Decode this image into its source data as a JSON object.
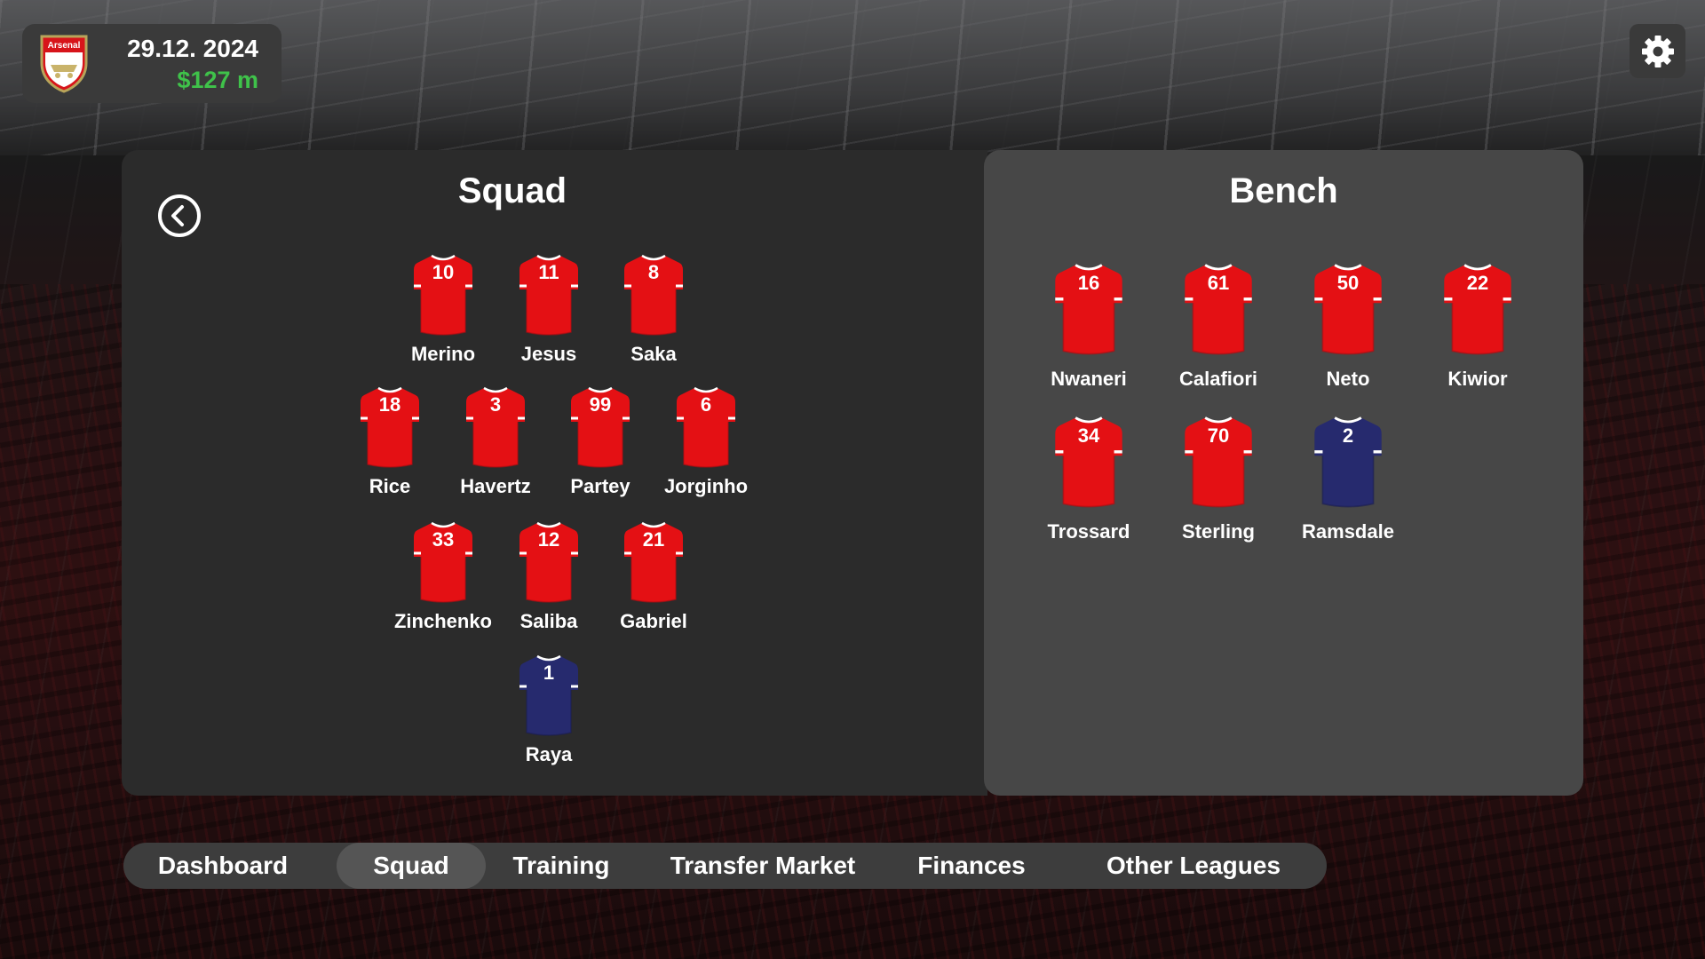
{
  "header": {
    "club_name": "Arsenal",
    "date": "29.12. 2024",
    "budget": "$127 m",
    "budget_color": "#3fc24a",
    "settings_icon": "gear-icon"
  },
  "squad": {
    "title": "Squad",
    "back_icon": "chevron-left-circle-icon",
    "players": [
      {
        "number": "10",
        "name": "Merino",
        "kit": "red"
      },
      {
        "number": "11",
        "name": "Jesus",
        "kit": "red"
      },
      {
        "number": "8",
        "name": "Saka",
        "kit": "red"
      },
      {
        "number": "18",
        "name": "Rice",
        "kit": "red"
      },
      {
        "number": "3",
        "name": "Havertz",
        "kit": "red"
      },
      {
        "number": "99",
        "name": "Partey",
        "kit": "red"
      },
      {
        "number": "6",
        "name": "Jorginho",
        "kit": "red"
      },
      {
        "number": "33",
        "name": "Zinchenko",
        "kit": "red"
      },
      {
        "number": "12",
        "name": "Saliba",
        "kit": "red"
      },
      {
        "number": "21",
        "name": "Gabriel",
        "kit": "red"
      },
      {
        "number": "1",
        "name": "Raya",
        "kit": "navy"
      }
    ]
  },
  "bench": {
    "title": "Bench",
    "players": [
      {
        "number": "16",
        "name": "Nwaneri",
        "kit": "red"
      },
      {
        "number": "61",
        "name": "Calafiori",
        "kit": "red"
      },
      {
        "number": "50",
        "name": "Neto",
        "kit": "red"
      },
      {
        "number": "22",
        "name": "Kiwior",
        "kit": "red"
      },
      {
        "number": "34",
        "name": "Trossard",
        "kit": "red"
      },
      {
        "number": "70",
        "name": "Sterling",
        "kit": "red"
      },
      {
        "number": "2",
        "name": "Ramsdale",
        "kit": "navy"
      }
    ]
  },
  "nav": {
    "items": [
      "Dashboard",
      "Squad",
      "Training",
      "Transfer Market",
      "Finances",
      "Other Leagues"
    ],
    "active": "Squad"
  },
  "colors": {
    "kit_red": "#e41014",
    "kit_navy": "#262a6e",
    "panel_squad": "#2b2b2b",
    "panel_bench": "#474747"
  }
}
